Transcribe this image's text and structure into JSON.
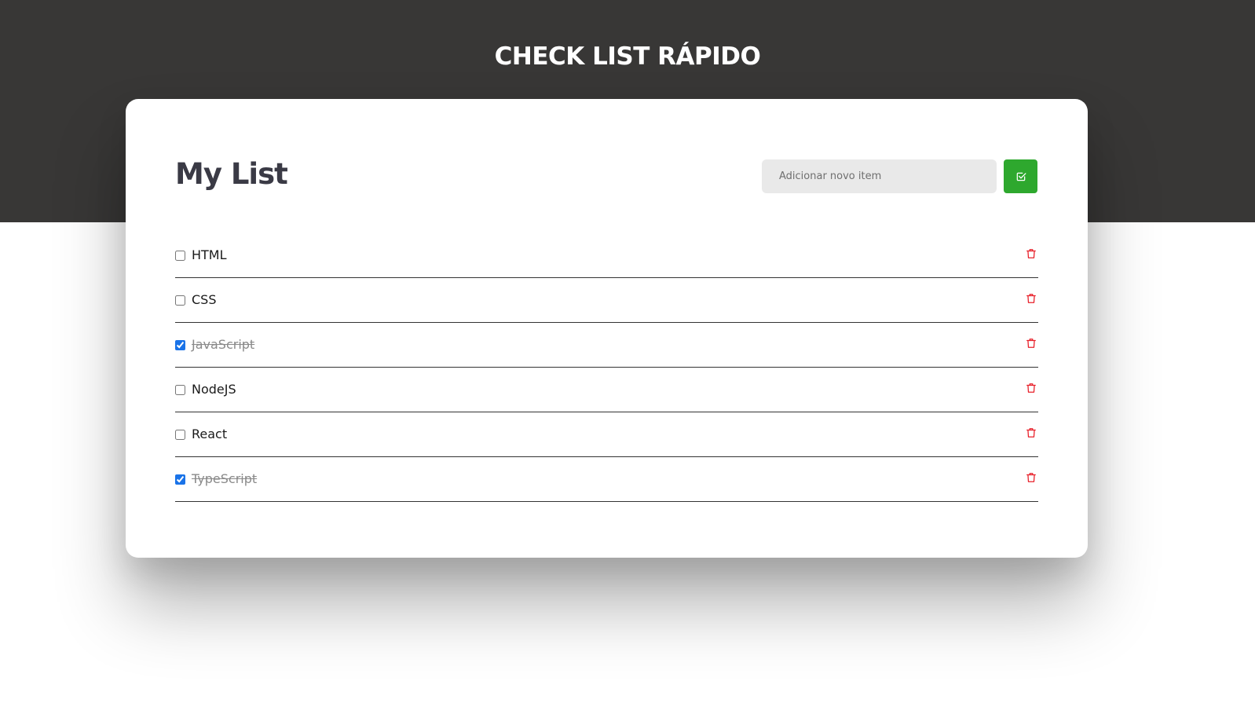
{
  "header": {
    "title": "CHECK LIST RÁPIDO"
  },
  "card": {
    "title": "My List",
    "new_item": {
      "value": "",
      "placeholder": "Adicionar novo item"
    },
    "add_button_icon": "check-square-icon",
    "delete_icon": "trash-icon",
    "items": [
      {
        "label": "HTML",
        "checked": false
      },
      {
        "label": "CSS",
        "checked": false
      },
      {
        "label": "JavaScript",
        "checked": true
      },
      {
        "label": "NodeJS",
        "checked": false
      },
      {
        "label": "React",
        "checked": false
      },
      {
        "label": "TypeScript",
        "checked": true
      }
    ]
  },
  "colors": {
    "header_bg": "#383736",
    "accent_green": "#2ea82e",
    "delete_red": "#e8202a",
    "checkbox_blue": "#1a73e8"
  }
}
